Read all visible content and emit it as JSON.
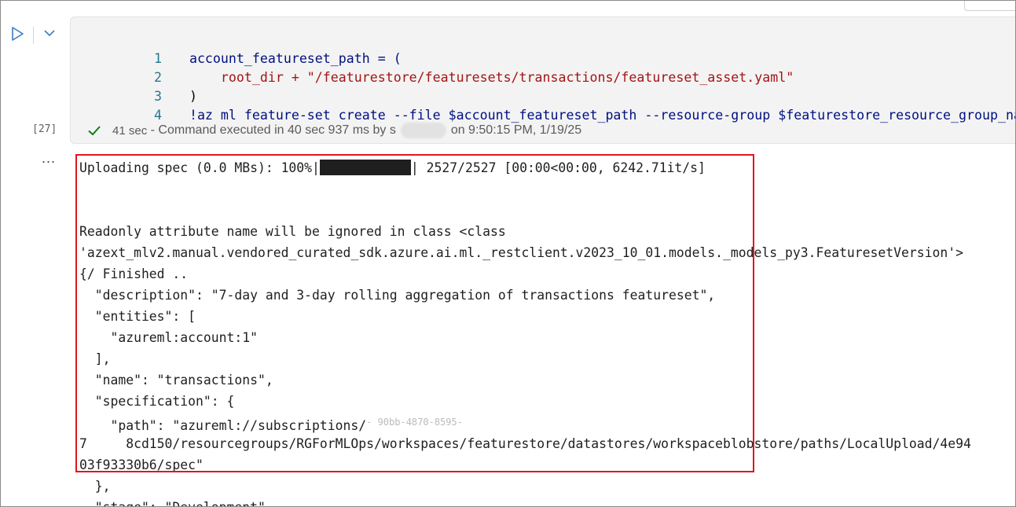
{
  "cell": {
    "execution_count": "[27]",
    "code_lines": [
      {
        "num": "1",
        "text": "account_featureset_path = ("
      },
      {
        "num": "2",
        "text": "    root_dir + \"/featurestore/featuresets/transactions/featureset_asset.yaml\""
      },
      {
        "num": "3",
        "text": ")"
      },
      {
        "num": "4",
        "text": "!az ml feature-set create --file $account_featureset_path --resource-group $featurestore_resource_group_name"
      }
    ],
    "status": {
      "duration": "41 sec",
      "message": "- Command executed in 40 sec 937 ms by",
      "redacted_name": "s",
      "timestamp": "on 9:50:15 PM, 1/19/25"
    }
  },
  "output": {
    "more_label": "...",
    "progress": {
      "prefix": "Uploading spec (0.0 MBs): 100%|",
      "suffix": "| 2527/2527 [00:00<00:00, 6242.71it/s]",
      "fraction": 1.0
    },
    "lines": [
      "",
      "",
      "Readonly attribute name will be ignored in class <class",
      "'azext_mlv2.manual.vendored_curated_sdk.azure.ai.ml._restclient.v2023_10_01.models._models_py3.FeaturesetVersion'>",
      "{/ Finished ..",
      "  \"description\": \"7-day and 3-day rolling aggregation of transactions featureset\",",
      "  \"entities\": [",
      "    \"azureml:account:1\"",
      "  ],",
      "  \"name\": \"transactions\",",
      "  \"specification\": {",
      "    \"path\": \"azureml://subscriptions/",
      "7     8cd150/resourcegroups/RGForMLOps/workspaces/featurestore/datastores/workspaceblobstore/paths/LocalUpload/4e94",
      "03f93330b6/spec\"",
      "  },",
      "  \"stage\": \"Development\","
    ],
    "partial_redacted_fragment": "- 90bb-4870-8595-"
  },
  "colors": {
    "highlight_border": "#e0161e",
    "line_number": "#237893",
    "string": "#a31515",
    "variable": "#001080",
    "success_check": "#107c10",
    "run_icon": "#3b79c7"
  },
  "icons": {
    "run": "play-triangle-icon",
    "expand": "chevron-down-icon",
    "status": "checkmark-icon",
    "more": "ellipsis-icon"
  }
}
